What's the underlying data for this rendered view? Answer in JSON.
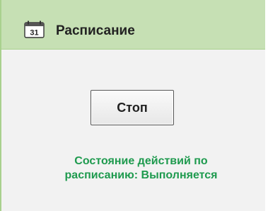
{
  "colors": {
    "header_bg": "#c6e0b4",
    "panel_bg": "#f2f2f2",
    "accent_border": "#a9d18e",
    "status_text": "#1e9a4e"
  },
  "header": {
    "icon": "calendar-icon",
    "icon_day": "31",
    "title": "Расписание"
  },
  "main": {
    "stop_label": "Стоп",
    "status_line1": "Состояние действий по",
    "status_line2": "расписанию: Выполняется"
  }
}
